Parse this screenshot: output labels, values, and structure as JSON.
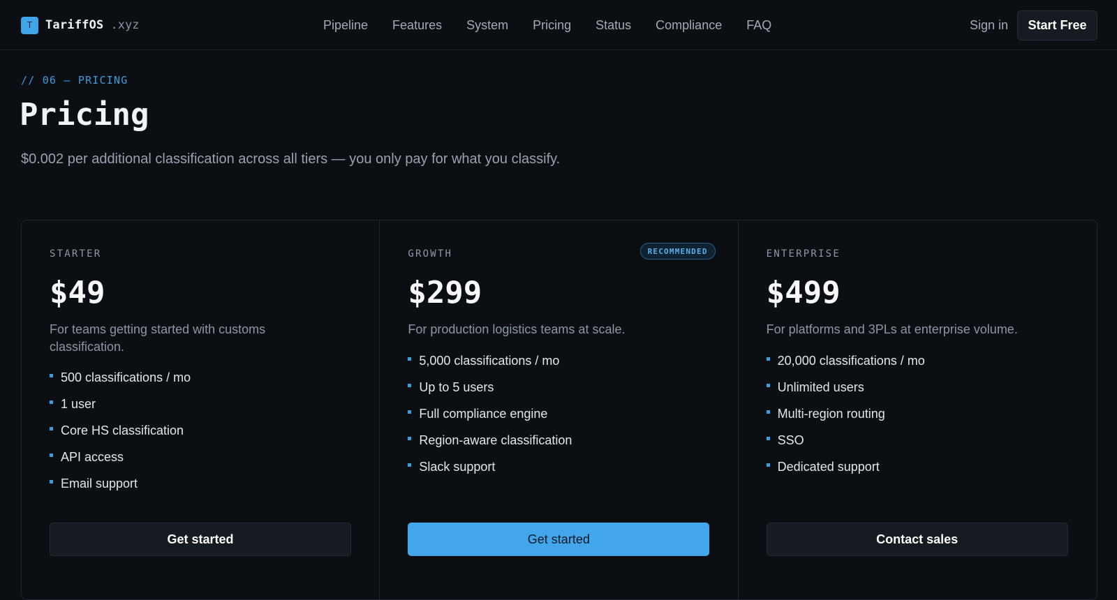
{
  "header": {
    "brand_mark": "T",
    "brand_name": "TariffOS",
    "brand_tld": ".xyz",
    "nav": [
      "Pipeline",
      "Features",
      "System",
      "Pricing",
      "Status",
      "Compliance",
      "FAQ"
    ],
    "sign_in": "Sign in",
    "start_free": "Start Free"
  },
  "section": {
    "eyebrow": "// 06 — PRICING",
    "title": "Pricing",
    "subtitle": "$0.002 per additional classification across all tiers — you only pay for what you classify."
  },
  "plans": [
    {
      "name": "STARTER",
      "price": "$49",
      "description": "For teams getting started with customs classification.",
      "features": [
        "500 classifications / mo",
        "1 user",
        "Core HS classification",
        "API access",
        "Email support"
      ],
      "cta": "Get started"
    },
    {
      "name": "GROWTH",
      "badge": "RECOMMENDED",
      "price": "$299",
      "description": "For production logistics teams at scale.",
      "features": [
        "5,000 classifications / mo",
        "Up to 5 users",
        "Full compliance engine",
        "Region-aware classification",
        "Slack support"
      ],
      "cta": "Get started"
    },
    {
      "name": "ENTERPRISE",
      "price": "$499",
      "description": "For platforms and 3PLs at enterprise volume.",
      "features": [
        "20,000 classifications / mo",
        "Unlimited users",
        "Multi-region routing",
        "SSO",
        "Dedicated support"
      ],
      "cta": "Contact sales"
    }
  ],
  "colors": {
    "background": "#0b0e12",
    "accent": "#44a6ea",
    "border": "#1f252d"
  }
}
